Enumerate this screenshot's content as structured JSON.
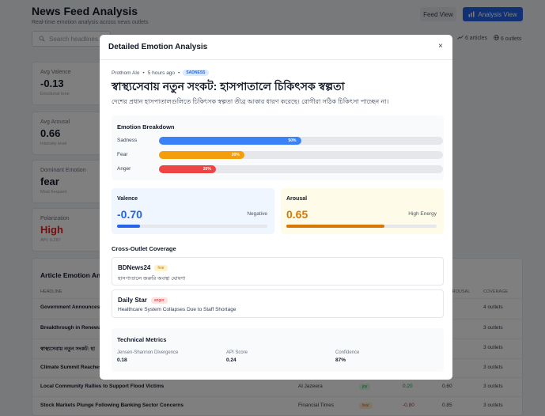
{
  "app": {
    "title": "News Feed Analysis",
    "subtitle": "Real-time emotion analysis across news outlets",
    "feed_view_label": "Feed View",
    "analysis_view_label": "Analysis View",
    "search_placeholder": "Search headlines...",
    "articles_count": "6 articles",
    "outlets_count": "6 outlets"
  },
  "stats": [
    {
      "label": "Avg Valence",
      "value": "-0.13",
      "sub": "Emotional tone"
    },
    {
      "label": "Avg Arousal",
      "value": "0.66",
      "sub": "Intensity level"
    },
    {
      "label": "Dominant Emotion",
      "value": "fear",
      "sub": "Most frequent"
    },
    {
      "label": "Polarization",
      "value": "High",
      "sub": "API: 0.287"
    }
  ],
  "table": {
    "title": "Article Emotion Analysis",
    "headers": [
      "HEADLINE",
      "AROUSAL",
      "COVERAGE"
    ],
    "rows": [
      {
        "headline": "Government Announces",
        "outlet": "",
        "emotion": "",
        "valence": "",
        "arousal": "",
        "coverage": "4 outlets"
      },
      {
        "headline": "Breakthrough in Renewab",
        "outlet": "",
        "emotion": "",
        "valence": "",
        "arousal": "",
        "coverage": "3 outlets"
      },
      {
        "headline": "স্বাস্থ্যসেবায় নতুন সংকট: হা",
        "outlet": "",
        "emotion": "",
        "valence": "",
        "arousal": "",
        "coverage": "3 outlets"
      },
      {
        "headline": "Climate Summit Reaches",
        "outlet": "",
        "emotion": "",
        "valence": "",
        "arousal": "",
        "coverage": "3 outlets"
      },
      {
        "headline": "Local Community Rallies to Support Flood Victims",
        "outlet": "Al Jazeera",
        "emotion": "joy",
        "valence": "0.20",
        "arousal": "0.60",
        "coverage": "3 outlets"
      },
      {
        "headline": "Stock Markets Plunge Following Banking Sector Concerns",
        "outlet": "Financial Times",
        "emotion": "fear",
        "valence": "-0.80",
        "arousal": "0.85",
        "coverage": "3 outlets"
      }
    ]
  },
  "modal": {
    "title": "Detailed Emotion Analysis",
    "close": "×",
    "source": "Prothom Alo",
    "sep": "•",
    "time": "5 hours ago",
    "emotion_badge": "SADNESS",
    "headline": "স্বাস্থ্যসেবায় নতুন সংকট: হাসপাতালে চিকিৎসক স্বল্পতা",
    "summary": "দেশের প্রধান হাসপাতালগুলিতে চিকিৎসক স্বল্পতা তীব্র আকার ধারণ করেছে। রোগীরা সঠিক চিকিৎসা পাচ্ছেন না।",
    "breakdown_title": "Emotion Breakdown",
    "emotions": [
      {
        "label": "Sadness",
        "pct": 50,
        "pct_label": "50%",
        "color": "#3b82f6"
      },
      {
        "label": "Fear",
        "pct": 30,
        "pct_label": "30%",
        "color": "#f59e0b"
      },
      {
        "label": "Anger",
        "pct": 20,
        "pct_label": "20%",
        "color": "#ef4444"
      }
    ],
    "valence": {
      "label": "Valence",
      "value": "-0.70",
      "desc": "Negative",
      "level": 0.15,
      "color": "#2563eb"
    },
    "arousal": {
      "label": "Arousal",
      "value": "0.65",
      "desc": "High Energy",
      "level": 0.65,
      "color": "#d97706"
    },
    "coverage_title": "Cross-Outlet Coverage",
    "outlets": [
      {
        "name": "BDNews24",
        "emotion": "fear",
        "headline": "হাসপাতালে জরুরি অবস্থা ঘোষণা"
      },
      {
        "name": "Daily Star",
        "emotion": "anger",
        "headline": "Healthcare System Collapses Due to Staff Shortage"
      }
    ],
    "tech_title": "Technical Metrics",
    "tech": [
      {
        "label": "Jensen-Shannon Divergence",
        "value": "0.18"
      },
      {
        "label": "API Score",
        "value": "0.24"
      },
      {
        "label": "Confidence",
        "value": "87%"
      }
    ]
  },
  "colors": {
    "primary": "#2563eb",
    "negative": "#dc2626",
    "fear": "#f59e0b",
    "anger": "#ef4444",
    "joy": "#16a34a"
  }
}
